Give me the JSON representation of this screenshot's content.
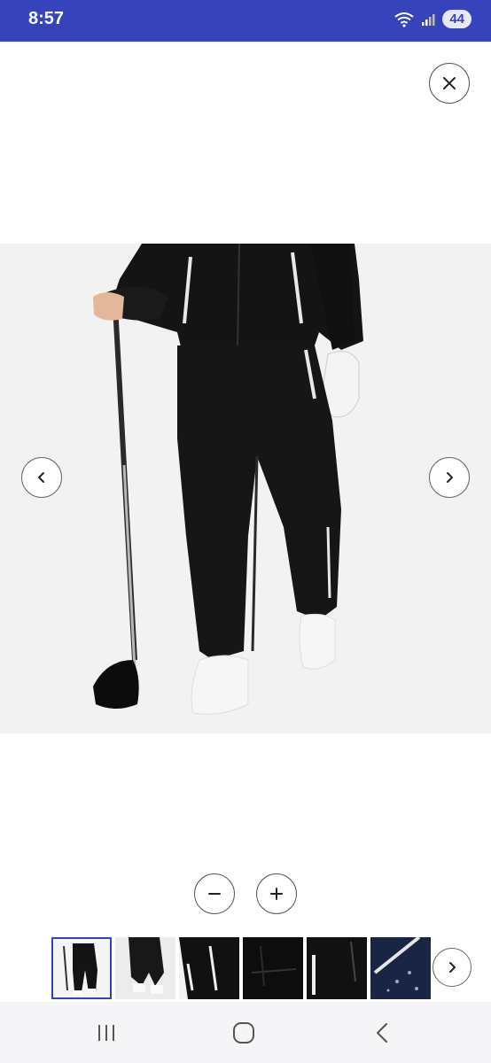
{
  "status_bar": {
    "time": "8:57",
    "battery": "44",
    "background": "#3643ba"
  },
  "viewer": {
    "close_icon": "close-icon",
    "prev_icon": "chevron-left-icon",
    "next_icon": "chevron-right-icon",
    "zoom_out_icon": "minus-icon",
    "zoom_in_icon": "plus-icon",
    "image_subject": "golf-rain-trousers-photo"
  },
  "thumbnails": {
    "count_visible": 6,
    "selected_index": 0,
    "accent": "#3643ba"
  },
  "system_nav": {
    "recent_icon": "recent-apps-icon",
    "home_icon": "home-icon",
    "back_icon": "back-icon"
  }
}
